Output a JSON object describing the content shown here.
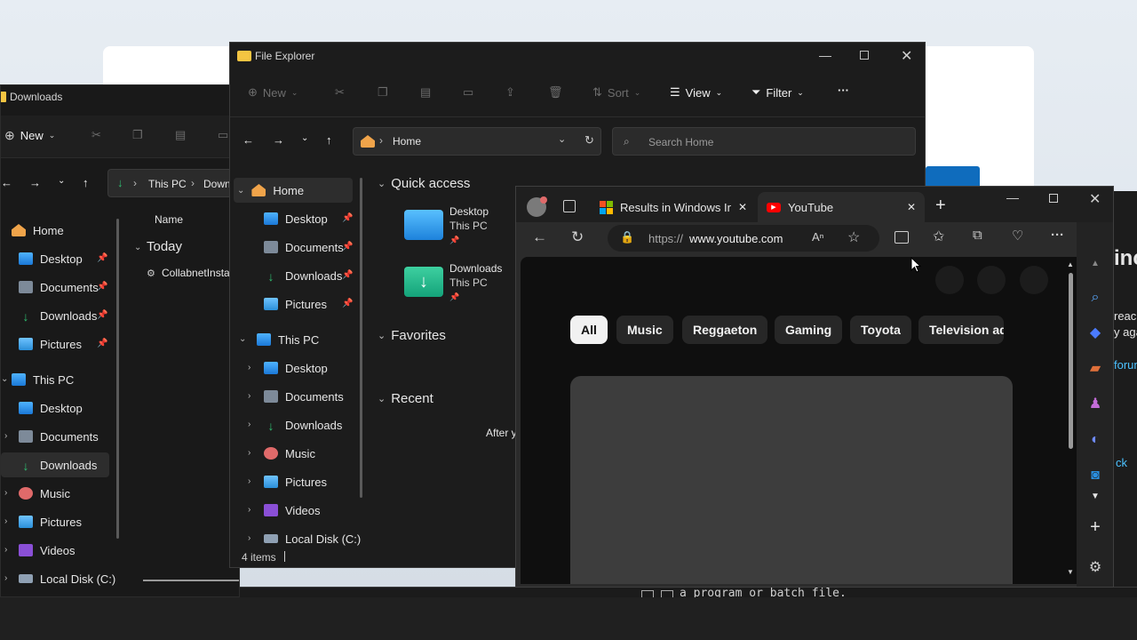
{
  "colors": {
    "accent": "#0f6cbd",
    "folder": "#f4c542",
    "download_green": "#2fbf71"
  },
  "downloads_window": {
    "title": "Downloads",
    "new_label": "New",
    "address": {
      "seg1": "This PC",
      "seg2": "Down"
    },
    "column_name": "Name",
    "group_today": "Today",
    "file_name": "CollabnetInsta",
    "nav": {
      "home": "Home",
      "desktop": "Desktop",
      "documents": "Documents",
      "downloads": "Downloads",
      "pictures": "Pictures",
      "this_pc": "This PC",
      "pc_desktop": "Desktop",
      "pc_documents": "Documents",
      "pc_downloads": "Downloads",
      "pc_music": "Music",
      "pc_pictures": "Pictures",
      "pc_videos": "Videos",
      "pc_local_disk": "Local Disk (C:)"
    }
  },
  "file_explorer": {
    "title": "File Explorer",
    "toolbar": {
      "new": "New",
      "sort": "Sort",
      "view": "View",
      "filter": "Filter",
      "more": "···"
    },
    "address": "Home",
    "search_placeholder": "Search Home",
    "nav": {
      "home": "Home",
      "desktop": "Desktop",
      "documents": "Documents",
      "downloads": "Downloads",
      "pictures": "Pictures",
      "this_pc": "This PC",
      "pc_desktop": "Desktop",
      "pc_documents": "Documents",
      "pc_downloads": "Downloads",
      "pc_music": "Music",
      "pc_pictures": "Pictures",
      "pc_videos": "Videos",
      "pc_local_disk": "Local Disk (C:)"
    },
    "sections": {
      "quick_access": "Quick access",
      "favorites": "Favorites",
      "recent": "Recent"
    },
    "quick_access": [
      {
        "name": "Desktop",
        "location": "This PC"
      },
      {
        "name": "Downloads",
        "location": "This PC"
      }
    ],
    "recent_text": "After y",
    "status": "4 items"
  },
  "edge": {
    "tabs": [
      {
        "title": "Results in Windows Insi"
      },
      {
        "title": "YouTube"
      }
    ],
    "url_prefix": "https://",
    "url_domain": "www.youtube.com",
    "chips": [
      "All",
      "Music",
      "Reggaeton",
      "Gaming",
      "Toyota",
      "Television ad"
    ]
  },
  "right_window": {
    "title_frag": "inc",
    "line1": "reac",
    "line2": "y aga",
    "line3": "forun",
    "line4": "ck"
  },
  "terminal": {
    "text": "a program or batch file."
  }
}
